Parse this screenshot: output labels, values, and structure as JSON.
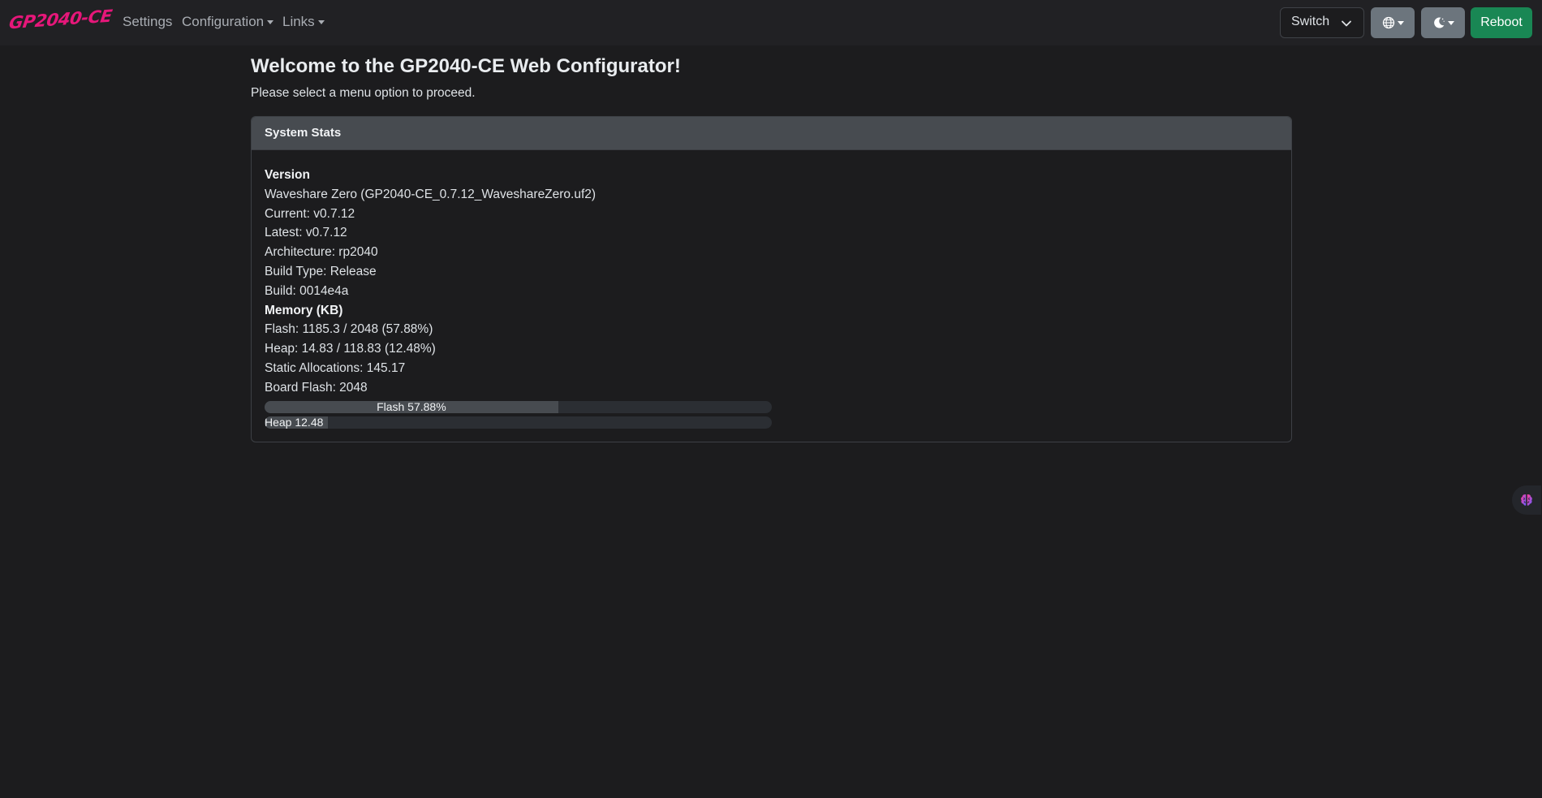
{
  "navbar": {
    "brand": "GP2040-CE",
    "links": [
      {
        "label": "Settings"
      },
      {
        "label": "Configuration"
      },
      {
        "label": "Links"
      }
    ],
    "mode_select": {
      "value": "Switch"
    },
    "reboot_label": "Reboot"
  },
  "main": {
    "title": "Welcome to the GP2040-CE Web Configurator!",
    "subtitle": "Please select a menu option to proceed."
  },
  "stats": {
    "header": "System Stats",
    "version_heading": "Version",
    "board": "Waveshare Zero (GP2040-CE_0.7.12_WaveshareZero.uf2)",
    "current": "Current: v0.7.12",
    "latest": "Latest: v0.7.12",
    "architecture": "Architecture: rp2040",
    "build_type": "Build Type: Release",
    "build": "Build: 0014e4a",
    "memory_heading": "Memory (KB)",
    "flash": "Flash: 1185.3 / 2048 (57.88%)",
    "heap": "Heap: 14.83 / 118.83 (12.48%)",
    "static_allocations": "Static Allocations: 145.17",
    "board_flash": "Board Flash: 2048",
    "flash_bar": {
      "label": "Flash 57.88%",
      "percent": 57.88
    },
    "heap_bar": {
      "label": "Heap 12.48",
      "percent": 12.48
    }
  },
  "colors": {
    "brand": "#e6177a",
    "reboot": "#198754",
    "secondary_button": "#6c757d"
  },
  "icons": {
    "language": "globe-icon",
    "theme": "moon-icon",
    "floating": "brain-icon"
  }
}
